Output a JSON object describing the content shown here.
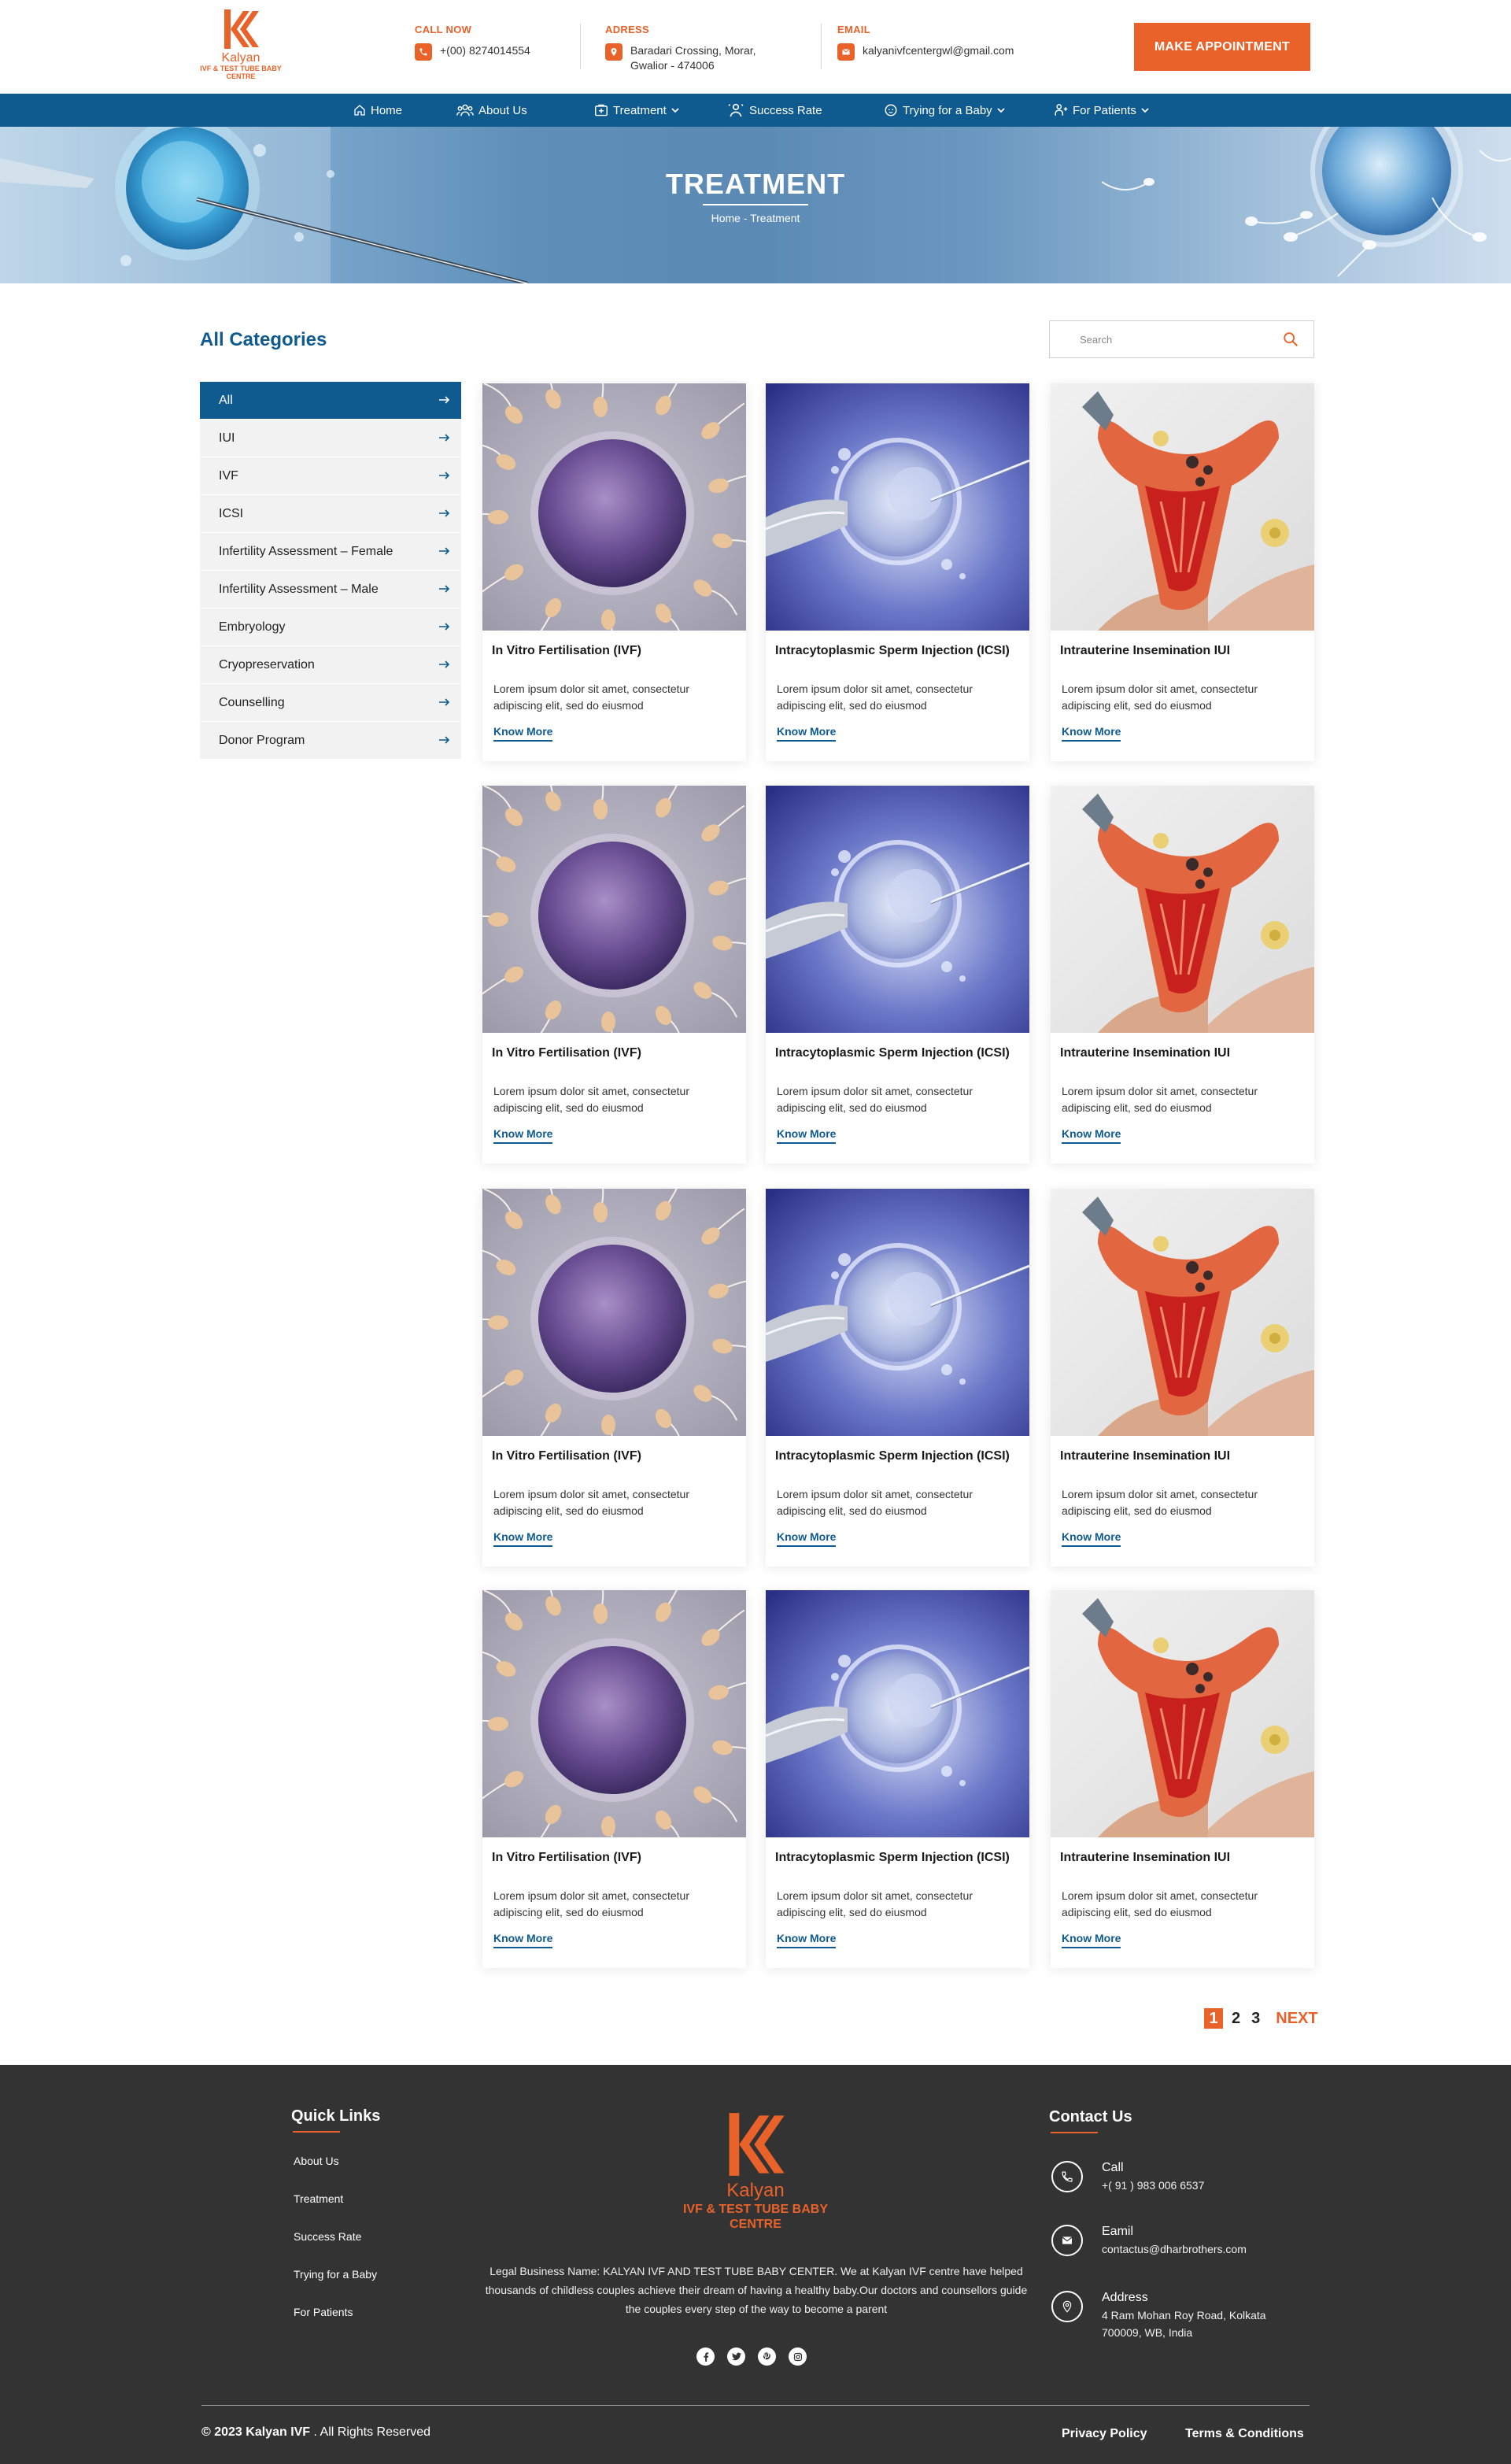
{
  "header": {
    "logo_brand": "Kalyan",
    "logo_sub_1": "IVF & TEST TUBE BABY",
    "logo_sub_2": "CENTRE",
    "call_label": "CALL NOW",
    "call_value": "+(00) 8274014554",
    "address_label": "ADRESS",
    "address_line1": "Baradari Crossing, Morar,",
    "address_line2": "Gwalior - 474006",
    "email_label": "EMAIL",
    "email_value": "kalyanivfcentergwl@gmail.com",
    "cta_label": "MAKE APPOINTMENT",
    "accent_color": "#e8622a",
    "brand_color": "#0f5a8f"
  },
  "nav": {
    "items": [
      {
        "label": "Home",
        "icon": "home-icon"
      },
      {
        "label": "About Us",
        "icon": "users-icon"
      },
      {
        "label": "Treatment",
        "icon": "treatment-icon",
        "dropdown": true
      },
      {
        "label": "Success Rate",
        "icon": "success-icon"
      },
      {
        "label": "Trying for a Baby",
        "icon": "baby-icon",
        "dropdown": true
      },
      {
        "label": "For Patients",
        "icon": "patients-icon",
        "dropdown": true
      }
    ]
  },
  "banner": {
    "title": "TREATMENT",
    "breadcrumb": "Home - Treatment"
  },
  "sidebar": {
    "title": "All Categories",
    "items": [
      {
        "label": "All",
        "active": true
      },
      {
        "label": "IUI"
      },
      {
        "label": "IVF"
      },
      {
        "label": "ICSI"
      },
      {
        "label": "Infertility Assessment – Female"
      },
      {
        "label": "Infertility Assessment – Male"
      },
      {
        "label": "Embryology"
      },
      {
        "label": "Cryopreservation"
      },
      {
        "label": "Counselling"
      },
      {
        "label": "Donor Program"
      }
    ]
  },
  "search": {
    "placeholder": "Search"
  },
  "cards": [
    {
      "title": "In Vitro Fertilisation (IVF)",
      "desc": "Lorem ipsum dolor sit amet, consectetur adipiscing elit, sed do eiusmod",
      "link": "Know More",
      "image": "ivf"
    },
    {
      "title": "Intracytoplasmic Sperm Injection (ICSI)",
      "desc": "Lorem ipsum dolor sit amet, consectetur adipiscing elit, sed do eiusmod",
      "link": "Know More",
      "image": "icsi"
    },
    {
      "title": "Intrauterine Insemination IUI",
      "desc": "Lorem ipsum dolor sit amet, consectetur adipiscing elit, sed do eiusmod",
      "link": "Know More",
      "image": "iui"
    },
    {
      "title": "In Vitro Fertilisation (IVF)",
      "desc": "Lorem ipsum dolor sit amet, consectetur adipiscing elit, sed do eiusmod",
      "link": "Know More",
      "image": "ivf"
    },
    {
      "title": "Intracytoplasmic Sperm Injection (ICSI)",
      "desc": "Lorem ipsum dolor sit amet, consectetur adipiscing elit, sed do eiusmod",
      "link": "Know More",
      "image": "icsi"
    },
    {
      "title": "Intrauterine Insemination IUI",
      "desc": "Lorem ipsum dolor sit amet, consectetur adipiscing elit, sed do eiusmod",
      "link": "Know More",
      "image": "iui"
    },
    {
      "title": "In Vitro Fertilisation (IVF)",
      "desc": "Lorem ipsum dolor sit amet, consectetur adipiscing elit, sed do eiusmod",
      "link": "Know More",
      "image": "ivf"
    },
    {
      "title": "Intracytoplasmic Sperm Injection (ICSI)",
      "desc": "Lorem ipsum dolor sit amet, consectetur adipiscing elit, sed do eiusmod",
      "link": "Know More",
      "image": "icsi"
    },
    {
      "title": "Intrauterine Insemination IUI",
      "desc": "Lorem ipsum dolor sit amet, consectetur adipiscing elit, sed do eiusmod",
      "link": "Know More",
      "image": "iui"
    },
    {
      "title": "In Vitro Fertilisation (IVF)",
      "desc": "Lorem ipsum dolor sit amet, consectetur adipiscing elit, sed do eiusmod",
      "link": "Know More",
      "image": "ivf"
    },
    {
      "title": "Intracytoplasmic Sperm Injection (ICSI)",
      "desc": "Lorem ipsum dolor sit amet, consectetur adipiscing elit, sed do eiusmod",
      "link": "Know More",
      "image": "icsi"
    },
    {
      "title": "Intrauterine Insemination IUI",
      "desc": "Lorem ipsum dolor sit amet, consectetur adipiscing elit, sed do eiusmod",
      "link": "Know More",
      "image": "iui"
    }
  ],
  "pagination": {
    "pages": [
      "1",
      "2",
      "3"
    ],
    "current": "1",
    "next": "NEXT"
  },
  "footer": {
    "quick_links_title": "Quick Links",
    "quick_links": [
      "About Us",
      "Treatment",
      "Success Rate",
      "Trying for a Baby",
      "For Patients"
    ],
    "logo_brand": "Kalyan",
    "logo_sub_1": "IVF & TEST TUBE BABY",
    "logo_sub_2": "CENTRE",
    "about_text": "Legal Business Name: KALYAN IVF AND TEST TUBE BABY CENTER. We at Kalyan IVF centre have helped thousands of childless couples achieve their dream of having a healthy baby.Our doctors and counsellors guide the couples every step of the way to become a parent",
    "socials": [
      "facebook-icon",
      "twitter-icon",
      "pinterest-icon",
      "instagram-icon"
    ],
    "contact_title": "Contact Us",
    "contacts": [
      {
        "label": "Call",
        "value": "+( 91 ) 983 006 6537",
        "icon": "phone-icon"
      },
      {
        "label": "Eamil",
        "value": "contactus@dharbrothers.com",
        "icon": "mail-icon"
      },
      {
        "label": "Address",
        "value_line1": "4 Ram Mohan Roy Road, Kolkata",
        "value_line2": "700009, WB, India",
        "icon": "location-icon"
      }
    ],
    "copyright_brand": "© 2023 Kalyan IVF",
    "copyright_rest": " . All Rights Reserved",
    "privacy": "Privacy Policy",
    "terms": "Terms & Conditions",
    "bg_color": "#333333"
  }
}
